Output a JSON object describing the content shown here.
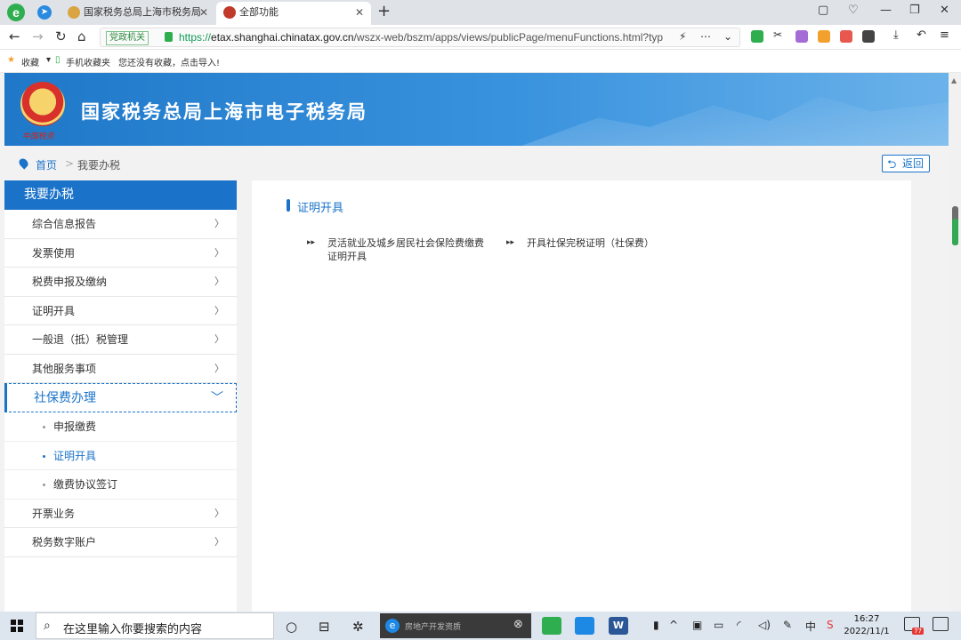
{
  "browser": {
    "tabs": [
      {
        "title": "国家税务总局上海市税务局"
      },
      {
        "title": "全部功能"
      }
    ],
    "url": {
      "gov_tag": "党政机关",
      "scheme": "https://",
      "host": "etax.shanghai.chinatax.gov.cn",
      "path": "/wszx-web/bszm/apps/views/publicPage/menuFunctions.html?typ"
    },
    "bookmarks": {
      "favorites": "收藏",
      "mobile": "手机收藏夹",
      "hint": "您还没有收藏，点击导入!"
    }
  },
  "site": {
    "title": "国家税务总局上海市电子税务局",
    "emblem_caption": "中国税务"
  },
  "breadcrumb": {
    "home": "首页",
    "separator": ">",
    "current": "我要办税",
    "back": "返回"
  },
  "sidebar": {
    "header": "我要办税",
    "items": [
      {
        "label": "综合信息报告",
        "chev": "〉"
      },
      {
        "label": "发票使用",
        "chev": "〉"
      },
      {
        "label": "税费申报及缴纳",
        "chev": "〉"
      },
      {
        "label": "证明开具",
        "chev": "〉"
      },
      {
        "label": "一般退（抵）税管理",
        "chev": "〉"
      },
      {
        "label": "其他服务事项",
        "chev": "〉"
      }
    ],
    "open_item": {
      "label": "社保费办理",
      "chev": "﹀"
    },
    "sub_items": [
      {
        "label": "申报缴费"
      },
      {
        "label": "证明开具"
      },
      {
        "label": "缴费协议签订"
      }
    ],
    "after_items": [
      {
        "label": "开票业务",
        "chev": "〉"
      },
      {
        "label": "税务数字账户",
        "chev": "〉"
      }
    ]
  },
  "content": {
    "section_title": "证明开具",
    "functions": [
      {
        "label": "灵活就业及城乡居民社会保险费缴费证明开具"
      },
      {
        "label": "开具社保完税证明（社保费）"
      }
    ]
  },
  "taskbar": {
    "search_placeholder": "在这里输入你要搜索的内容",
    "app_label": "房地产开发资质",
    "time": "16:27",
    "date": "2022/11/1",
    "notification_count": "77"
  },
  "colors": {
    "accent": "#1a73c9",
    "banner": "#3a93de"
  }
}
